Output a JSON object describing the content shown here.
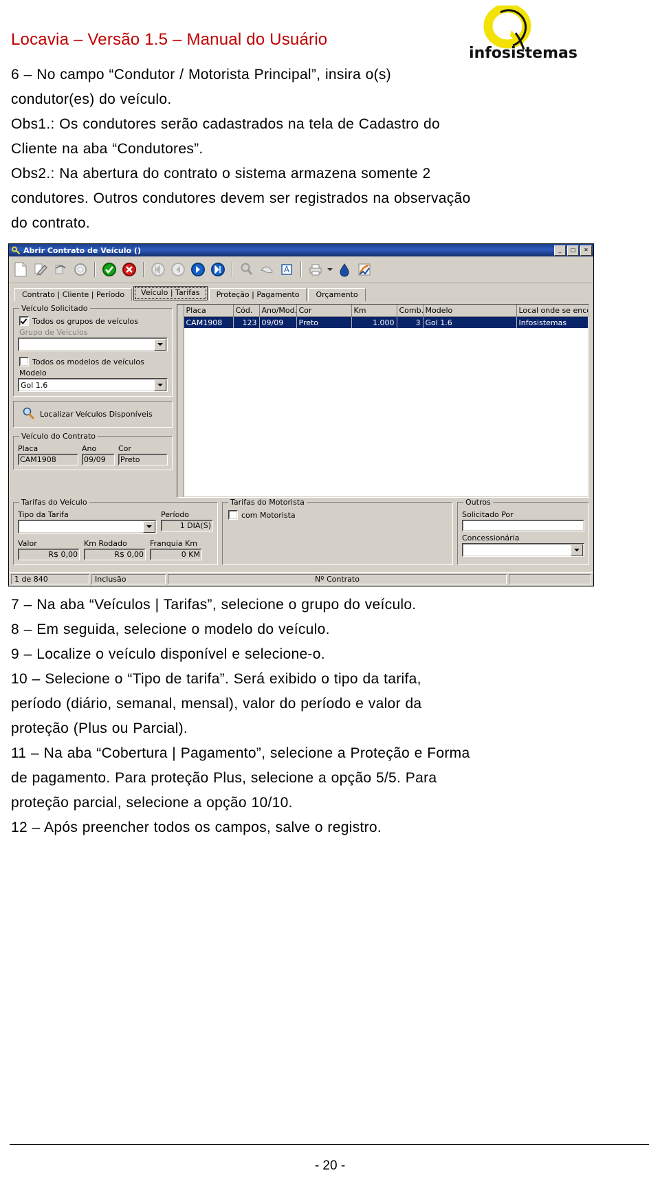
{
  "header": {
    "title": "Locavia  – Versão 1.5 – Manual do Usuário",
    "logo_text": "infosistemas"
  },
  "body": {
    "paragraphs": [
      "6 – No campo “Condutor / Motorista Principal”, insira o(s)",
      "condutor(es) do veículo.",
      "Obs1.: Os condutores serão cadastrados na tela de Cadastro do",
      "Cliente na aba “Condutores”.",
      "Obs2.: Na abertura do contrato o sistema armazena somente 2",
      "condutores. Outros condutores devem ser registrados na observação",
      "do contrato."
    ],
    "paragraphs_after": [
      "7 – Na aba “Veículos | Tarifas”, selecione o grupo do veículo.",
      "8 – Em seguida, selecione o modelo do veículo.",
      "9 – Localize o veículo disponível e selecione-o.",
      "10 – Selecione o “Tipo de tarifa”. Será exibido o tipo da tarifa,",
      "período (diário, semanal, mensal), valor do período e valor da",
      "proteção (Plus ou Parcial).",
      "11 – Na aba “Cobertura | Pagamento”, selecione a Proteção e Forma",
      "de pagamento. Para proteção Plus, selecione a opção 5/5. Para",
      "proteção parcial, selecione a opção 10/10.",
      "12 – Após preencher todos os campos, salve o registro."
    ]
  },
  "dialog": {
    "title": "Abrir Contrato de Veículo ()",
    "window_buttons": [
      "_",
      "□",
      "✕"
    ],
    "tabs": [
      {
        "label": "Contrato | Cliente | Período",
        "active": false
      },
      {
        "label": "Veículo | Tarifas",
        "active": true
      },
      {
        "label": "Proteção | Pagamento",
        "active": false
      },
      {
        "label": "Orçamento",
        "active": false
      }
    ],
    "toolbar_icons": [
      "new-document-icon",
      "edit-icon",
      "delete-icon",
      "clock-icon",
      "confirm-icon",
      "cancel-icon",
      "first-record-icon",
      "previous-record-icon",
      "next-record-icon",
      "last-record-icon",
      "search-icon",
      "filter-icon",
      "text-tool-icon",
      "print-icon",
      "print-dropdown-icon",
      "info-icon",
      "export-icon"
    ],
    "vehicle_requested": {
      "legend": "Veículo Solicitado",
      "all_groups_label": "Todos os grupos de veículos",
      "all_groups_checked": true,
      "group_label": "Grupo de Veículos",
      "group_value": "",
      "all_models_label": "Todos os modelos de veículos",
      "all_models_checked": false,
      "model_label": "Modelo",
      "model_value": "Gol 1.6"
    },
    "find_button": {
      "label": "Localizar Veículos Disponíveis",
      "icon": "search-icon"
    },
    "contract_vehicle": {
      "legend": "Veículo do Contrato",
      "fields": [
        {
          "label": "Placa",
          "value": "CAM1908"
        },
        {
          "label": "Ano",
          "value": "09/09"
        },
        {
          "label": "Cor",
          "value": "Preto"
        }
      ]
    },
    "grid": {
      "columns": [
        "Placa",
        "Cód.",
        "Ano/Mod.",
        "Cor",
        "Km",
        "Comb.",
        "Modelo",
        "Local onde se encontra"
      ],
      "rows": [
        {
          "cells": [
            "CAM1908",
            "123",
            "09/09",
            "Preto",
            "1.000",
            "3",
            "Gol 1.6",
            "Infosistemas"
          ],
          "selected": true
        }
      ]
    },
    "vehicle_tariffs": {
      "legend": "Tarifas do Veículo",
      "tariff_type_label": "Tipo da Tarifa",
      "tariff_type_value": "",
      "period_label": "Período",
      "period_value": "1 DIA(S)",
      "value_label": "Valor",
      "value_value": "R$      0,00",
      "km_label": "Km Rodado",
      "km_value": "R$      0,00",
      "franchise_label": "Franquia Km",
      "franchise_value": "0 KM"
    },
    "driver_tariffs": {
      "legend": "Tarifas do Motorista",
      "with_driver_label": "com Motorista",
      "with_driver_checked": false
    },
    "others": {
      "legend": "Outros",
      "requested_by_label": "Solicitado Por",
      "requested_by_value": "",
      "dealer_label": "Concessionária",
      "dealer_value": ""
    },
    "statusbar": {
      "record_counter": "1 de 840",
      "mode": "Inclusão",
      "contract_label": "Nº Contrato"
    }
  },
  "footer": {
    "page_number": "- 20 -"
  },
  "colors": {
    "title_red": "#c00000",
    "dialog_face": "#d4d0c8",
    "titlebar_blue": "#1b3f8b",
    "grid_selected": "#0a246a",
    "logo_yellow": "#f2e208"
  }
}
